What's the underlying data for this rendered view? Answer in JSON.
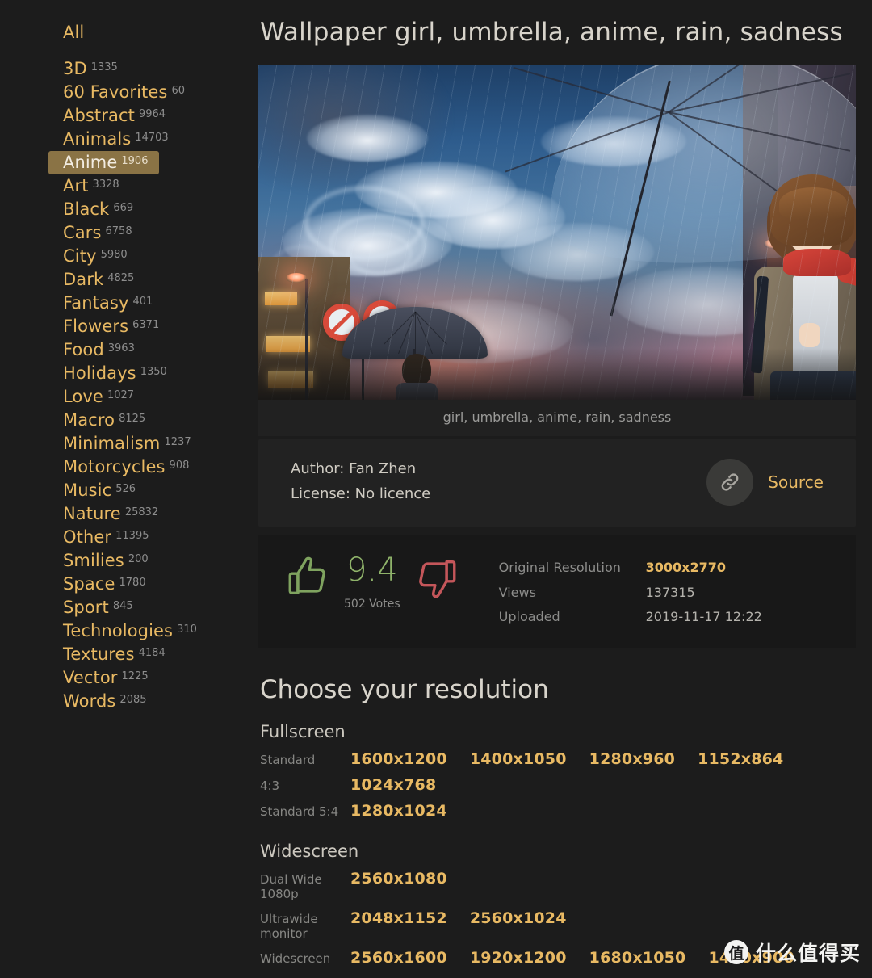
{
  "sidebar": {
    "all_label": "All",
    "items": [
      {
        "label": "3D",
        "count": "1335"
      },
      {
        "label": "60 Favorites",
        "count": "60"
      },
      {
        "label": "Abstract",
        "count": "9964"
      },
      {
        "label": "Animals",
        "count": "14703"
      },
      {
        "label": "Anime",
        "count": "1906",
        "active": true
      },
      {
        "label": "Art",
        "count": "3328"
      },
      {
        "label": "Black",
        "count": "669"
      },
      {
        "label": "Cars",
        "count": "6758"
      },
      {
        "label": "City",
        "count": "5980"
      },
      {
        "label": "Dark",
        "count": "4825"
      },
      {
        "label": "Fantasy",
        "count": "401"
      },
      {
        "label": "Flowers",
        "count": "6371"
      },
      {
        "label": "Food",
        "count": "3963"
      },
      {
        "label": "Holidays",
        "count": "1350"
      },
      {
        "label": "Love",
        "count": "1027"
      },
      {
        "label": "Macro",
        "count": "8125"
      },
      {
        "label": "Minimalism",
        "count": "1237"
      },
      {
        "label": "Motorcycles",
        "count": "908"
      },
      {
        "label": "Music",
        "count": "526"
      },
      {
        "label": "Nature",
        "count": "25832"
      },
      {
        "label": "Other",
        "count": "11395"
      },
      {
        "label": "Smilies",
        "count": "200"
      },
      {
        "label": "Space",
        "count": "1780"
      },
      {
        "label": "Sport",
        "count": "845"
      },
      {
        "label": "Technologies",
        "count": "310"
      },
      {
        "label": "Textures",
        "count": "4184"
      },
      {
        "label": "Vector",
        "count": "1225"
      },
      {
        "label": "Words",
        "count": "2085"
      }
    ]
  },
  "page": {
    "title": "Wallpaper girl, umbrella, anime, rain, sadness",
    "image_caption": "girl, umbrella, anime, rain, sadness"
  },
  "meta": {
    "author_line": "Author: Fan Zhen",
    "license_line": "License: No licence",
    "source_label": "Source",
    "source_icon": "link-icon"
  },
  "stats": {
    "thumb_up_icon": "thumbs-up-icon",
    "thumb_down_icon": "thumbs-down-icon",
    "score": "9.4",
    "votes": "502 Votes",
    "rows": [
      {
        "key": "Original Resolution",
        "value": "3000x2770",
        "highlight": true
      },
      {
        "key": "Views",
        "value": "137315",
        "highlight": false
      },
      {
        "key": "Uploaded",
        "value": "2019-11-17 12:22",
        "highlight": false
      }
    ]
  },
  "resolutions": {
    "heading": "Choose your resolution",
    "groups": [
      {
        "name": "Fullscreen",
        "rows": [
          {
            "label": "Standard",
            "links": [
              "1600x1200",
              "1400x1050",
              "1280x960",
              "1152x864"
            ]
          },
          {
            "label": "4:3",
            "links": [
              "1024x768"
            ]
          },
          {
            "label": "Standard 5:4",
            "links": [
              "1280x1024"
            ]
          }
        ]
      },
      {
        "name": "Widescreen",
        "rows": [
          {
            "label": "Dual Wide 1080p",
            "links": [
              "2560x1080"
            ]
          },
          {
            "label": "Ultrawide monitor",
            "links": [
              "2048x1152",
              "2560x1024"
            ]
          },
          {
            "label": "Widescreen",
            "links": [
              "2560x1600",
              "1920x1200",
              "1680x1050",
              "1440x900"
            ]
          }
        ]
      }
    ]
  },
  "watermark": {
    "badge": "值",
    "text": "什么值得买"
  },
  "colors": {
    "background": "#1c1c1c",
    "accent": "#e8b963",
    "active_bg": "#8a7345",
    "score_green": "#8fb36a",
    "thumb_down_red": "#c4565a"
  }
}
